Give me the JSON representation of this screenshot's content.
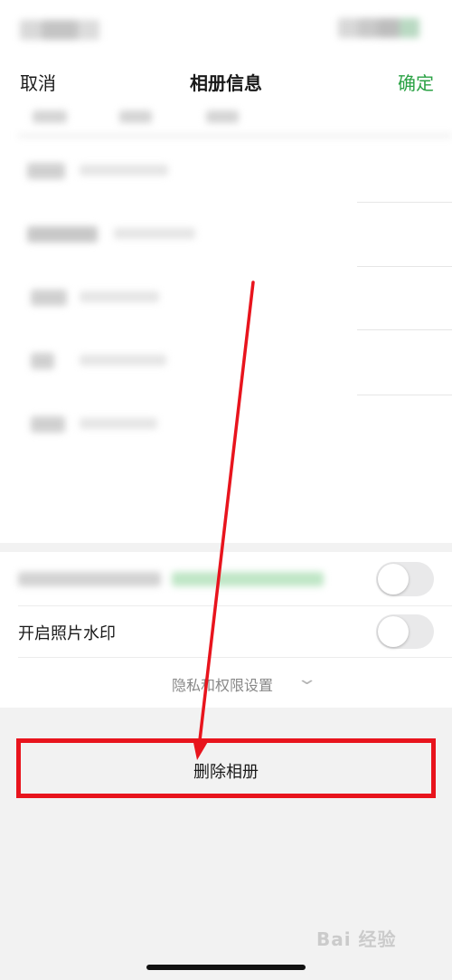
{
  "nav": {
    "cancel_label": "取消",
    "title": "相册信息",
    "confirm_label": "确定"
  },
  "settings": {
    "watermark_label": "开启照片水印",
    "privacy_label": "隐私和权限设置"
  },
  "delete_label": "删除相册",
  "watermark_text": "Bai 经验",
  "colors": {
    "confirm_green": "#2ba245",
    "highlight_red": "#e8141d",
    "background_gray": "#f2f2f2"
  },
  "icons": {
    "privacy_expand": "chevron-down-icon",
    "arrow": "annotation-arrow"
  }
}
